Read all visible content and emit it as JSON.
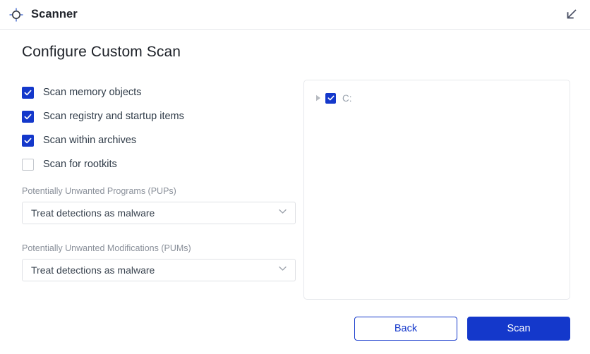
{
  "window": {
    "app_title": "Scanner",
    "app_icon": "crosshair-target-icon",
    "collapse_icon": "arrow-down-left-icon",
    "accent_color": "#1438cb",
    "text_color": "#2e3a47",
    "muted_color": "#8a909a"
  },
  "page": {
    "title": "Configure Custom Scan"
  },
  "options": {
    "checkboxes": [
      {
        "label": "Scan memory objects",
        "checked": true
      },
      {
        "label": "Scan registry and startup items",
        "checked": true
      },
      {
        "label": "Scan within archives",
        "checked": true
      },
      {
        "label": "Scan for rootkits",
        "checked": false
      }
    ],
    "pups": {
      "label": "Potentially Unwanted Programs (PUPs)",
      "value": "Treat detections as malware",
      "chevron_icon": "chevron-down-icon"
    },
    "pums": {
      "label": "Potentially Unwanted Modifications (PUMs)",
      "value": "Treat detections as malware",
      "chevron_icon": "chevron-down-icon"
    }
  },
  "tree": {
    "items": [
      {
        "label": "C:",
        "checked": true,
        "expanded": false,
        "expander_icon": "triangle-right-icon"
      }
    ]
  },
  "footer": {
    "back_label": "Back",
    "scan_label": "Scan"
  }
}
